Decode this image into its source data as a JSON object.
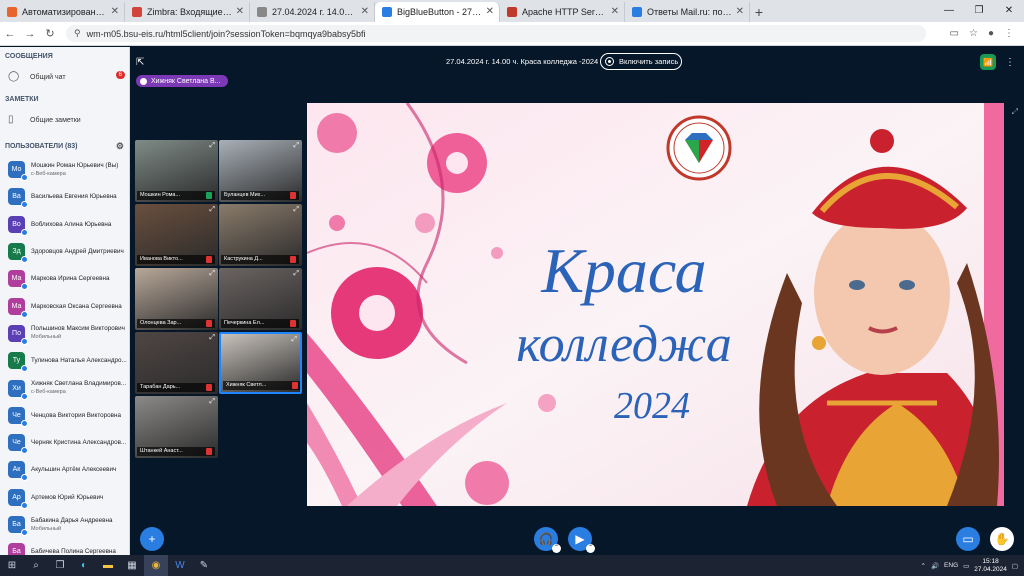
{
  "browser": {
    "tabs": [
      {
        "title": "Автоматизированные систе",
        "color": "#e8642c"
      },
      {
        "title": "Zimbra: Входящие (1939)",
        "color": "#d1453b"
      },
      {
        "title": "27.04.2024 г. 14.00 ч. Краса к",
        "color": "#777777"
      },
      {
        "title": "BigBlueButton - 27.04.2024",
        "color": "#2a7de1",
        "active": true
      },
      {
        "title": "Apache HTTP Server Test Page",
        "color": "#c0392b"
      },
      {
        "title": "Ответы Mail.ru: помогите пла",
        "color": "#2a7de1"
      }
    ],
    "new_tab": "+",
    "url": "wm-m05.bsu-eis.ru/html5client/join?sessionToken=bqmqya9babsy5bfi"
  },
  "sidebar": {
    "messages_title": "СООБЩЕНИЯ",
    "public_chat": "Общий чат",
    "chat_badge": "6",
    "notes_title": "ЗАМЕТКИ",
    "shared_notes": "Общие заметки",
    "users_title": "ПОЛЬЗОВАТЕЛИ (83)",
    "users": [
      {
        "initials": "Мо",
        "name": "Мошкин Роман Юрьевич (Вы)",
        "sub": "с-Веб-камера",
        "color": "#2e6fbf"
      },
      {
        "initials": "Ва",
        "name": "Васильева Евгения Юрьевна",
        "sub": "",
        "color": "#2e6fbf"
      },
      {
        "initials": "Во",
        "name": "Воблихова Алина Юрьевна",
        "sub": "",
        "color": "#5b3fb5"
      },
      {
        "initials": "Зд",
        "name": "Здоровцов Андрей Дмитриевич",
        "sub": "",
        "color": "#167a4a"
      },
      {
        "initials": "Ма",
        "name": "Маркова Ирина Сергеевна",
        "sub": "",
        "color": "#b03e9c"
      },
      {
        "initials": "Ма",
        "name": "Марковская Оксана Сергеевна",
        "sub": "",
        "color": "#b03e9c"
      },
      {
        "initials": "По",
        "name": "Польшинов Максим Викторович",
        "sub": "Мобильный",
        "color": "#5b3fb5"
      },
      {
        "initials": "Ту",
        "name": "Тулинова Наталья Александро...",
        "sub": "",
        "color": "#167a4a"
      },
      {
        "initials": "Хи",
        "name": "Хижняк Светлана Владимиров...",
        "sub": "с-Веб-камера",
        "color": "#2e6fbf"
      },
      {
        "initials": "Че",
        "name": "Ченцова Виктория Викторовна",
        "sub": "",
        "color": "#2e6fbf"
      },
      {
        "initials": "Че",
        "name": "Черняк Кристина Александров...",
        "sub": "",
        "color": "#2e6fbf"
      },
      {
        "initials": "Ак",
        "name": "Акульшин Артём Алексеевич",
        "sub": "",
        "color": "#2e6fbf"
      },
      {
        "initials": "Ар",
        "name": "Артемов Юрий Юрьевич",
        "sub": "",
        "color": "#2e6fbf"
      },
      {
        "initials": "Ба",
        "name": "Бабакина Дарья Андреевна",
        "sub": "Мобильный",
        "color": "#2e6fbf"
      },
      {
        "initials": "Ба",
        "name": "Бабичева Полина Сергеевна",
        "sub": "",
        "color": "#b03e9c"
      }
    ]
  },
  "meeting": {
    "title": "27.04.2024 г. 14.00 ч. Краса колледжа -2024",
    "record_label": "Включить запись",
    "presenter": "Хижняк Светлана В..."
  },
  "videos": [
    {
      "name": "Мошкин Рома...",
      "muted": false
    },
    {
      "name": "Буланцев Мих...",
      "muted": true
    },
    {
      "name": "Иванова Викто...",
      "muted": true
    },
    {
      "name": "Каструкина Д...",
      "muted": true
    },
    {
      "name": "Олонцева Зар...",
      "muted": true
    },
    {
      "name": "Печеркина Ел...",
      "muted": true
    },
    {
      "name": "Тарабан Дарь...",
      "muted": true
    },
    {
      "name": "Хижняк Светл...",
      "muted": true
    },
    {
      "name": "Штанкей Анаст...",
      "muted": true
    }
  ],
  "slide": {
    "title_line1": "Краса",
    "title_line2": "колледжа",
    "year": "2024",
    "logo_text": "ПОЛИТЕХНИЧЕСКИЙ КОЛЛЕДЖ"
  },
  "taskbar": {
    "lang": "ENG",
    "time": "15:18",
    "date": "27.04.2024"
  }
}
